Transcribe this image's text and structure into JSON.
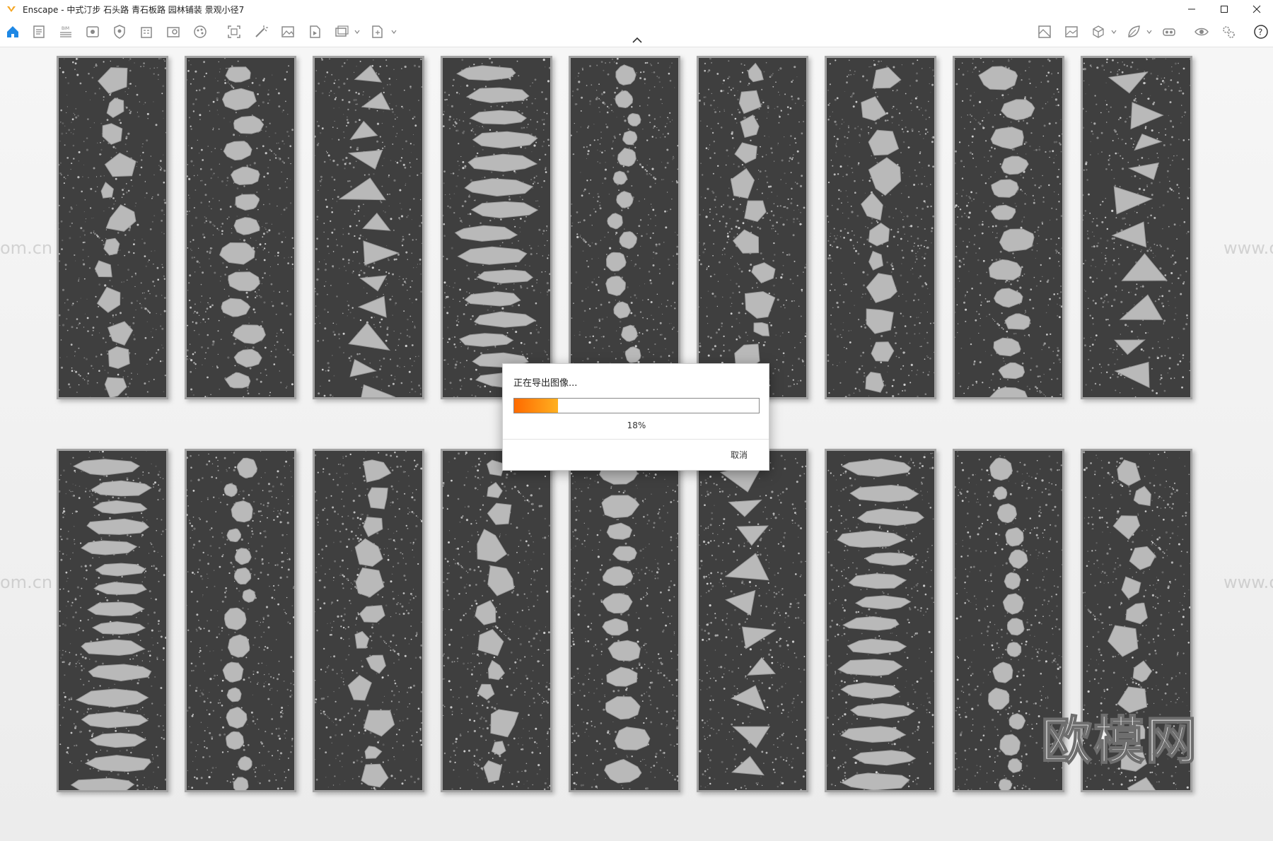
{
  "window": {
    "app_name": "Enscape",
    "title": "Enscape - 中式汀步 石头路 青石板路 园林铺装 景观小径7",
    "controls": [
      "minimize",
      "maximize",
      "close"
    ]
  },
  "toolbar": {
    "left_icons": [
      "home-icon",
      "document-icon",
      "bim-list-icon",
      "view-icon",
      "shield-icon",
      "building-icon",
      "material-icon",
      "palette-icon",
      "capture-icon",
      "wand-icon",
      "image-icon",
      "video-file-icon",
      "batch-export-icon",
      "export-file-icon"
    ],
    "right_icons": [
      "map-view-icon",
      "gallery-icon",
      "cube-icon",
      "leaf-icon",
      "vr-headset-icon",
      "visual-settings-icon",
      "settings-icon",
      "help-icon"
    ]
  },
  "viewport": {
    "watermarks": [
      "om.cn",
      "om.cn",
      "www.o",
      "www.o"
    ],
    "brand_text": "欧模网",
    "panel_count": 18
  },
  "export_dialog": {
    "title": "正在导出图像...",
    "progress_text": "18%",
    "progress_value": 0.18,
    "cancel_label": "取消",
    "progress_colors": [
      "#ff6a00",
      "#ffb020"
    ]
  }
}
